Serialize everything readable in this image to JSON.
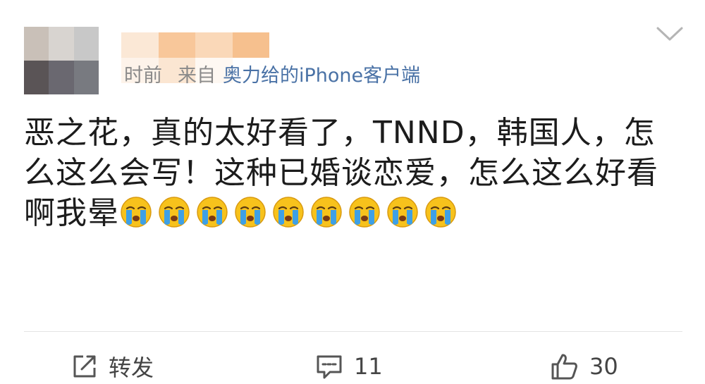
{
  "post": {
    "timestamp_fragment": "时前",
    "from_label": "来自",
    "client": "奥力给的iPhone客户端",
    "text": "恶之花，真的太好看了，TNND，韩国人，怎么这么会写！这种已婚谈恋爱，怎么这么好看啊我晕",
    "emoji_count": 9,
    "emoji_name": "crying-face-emoji"
  },
  "actions": {
    "repost_label": "转发",
    "comment_count": "11",
    "like_count": "30"
  },
  "colors": {
    "meta_gray": "#8a8a8a",
    "link_blue": "#4a72a6",
    "text": "#1c1c1c",
    "emoji_yellow": "#f7c21c",
    "tear_blue": "#3ea0e6"
  },
  "icons": {
    "menu": "chevron-down-icon",
    "repost": "share-icon",
    "comment": "comment-icon",
    "like": "thumbs-up-icon"
  }
}
